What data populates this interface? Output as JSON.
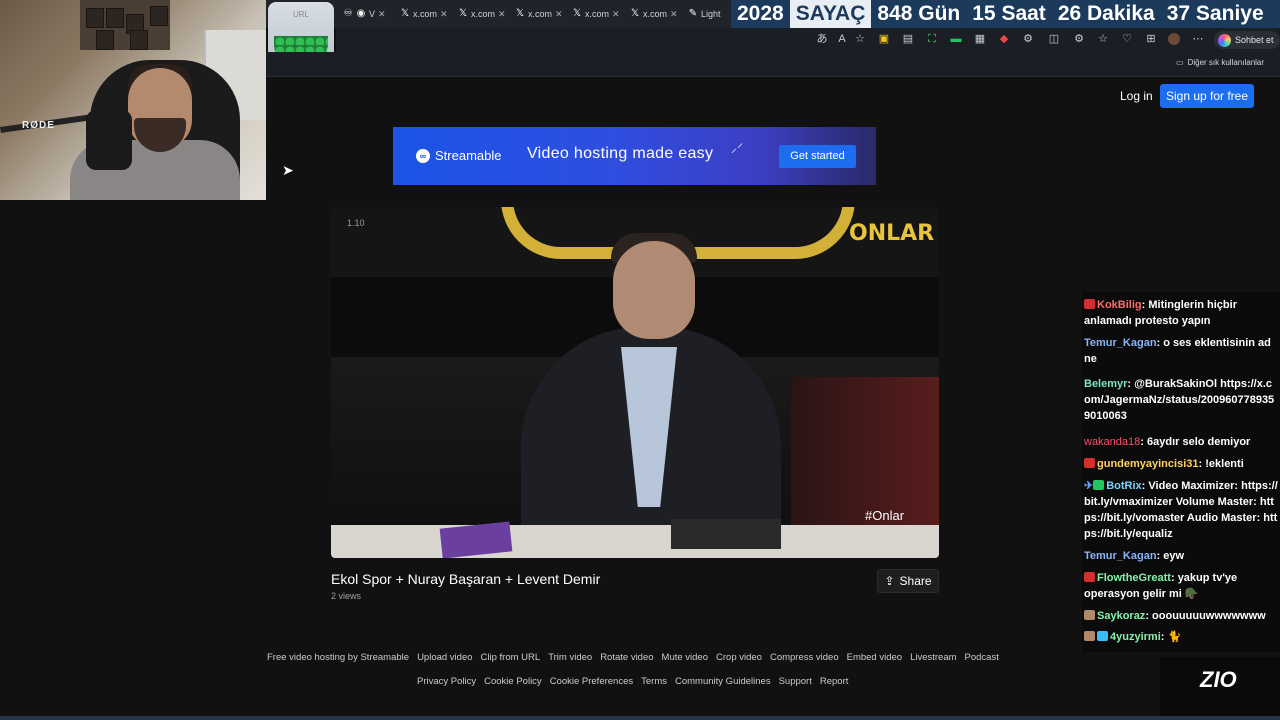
{
  "browser": {
    "url_widget_label": "URL",
    "tabs": [
      {
        "icon": "♾",
        "label": "V"
      },
      {
        "icon": "𝕏",
        "label": "x.com"
      },
      {
        "icon": "𝕏",
        "label": "x.com"
      },
      {
        "icon": "𝕏",
        "label": "x.com"
      },
      {
        "icon": "𝕏",
        "label": "x.com"
      },
      {
        "icon": "𝕏",
        "label": "x.com"
      },
      {
        "icon": "✎",
        "label": "Light"
      }
    ],
    "counter": {
      "year": "2028",
      "title": "SAYAÇ",
      "days": "848 Gün",
      "hours": "15 Saat",
      "minutes": "26 Dakika",
      "seconds": "37 Saniye"
    },
    "chat_button": "Sohbet et",
    "favorites_other": "Diğer sık kullanılanlar"
  },
  "header": {
    "login": "Log in",
    "signup": "Sign up for free"
  },
  "banner": {
    "brand": "Streamable",
    "tagline": "Video hosting made easy",
    "cta": "Get started"
  },
  "video": {
    "timestamp": "1.10",
    "channel_logo": "ONLAR",
    "hashtag": "#Onlar",
    "title": "Ekol Spor + Nuray Başaran + Levent Demir",
    "views": "2 views",
    "share": "Share"
  },
  "footer": {
    "row1": [
      "Free video hosting by Streamable",
      "Upload video",
      "Clip from URL",
      "Trim video",
      "Rotate video",
      "Mute video",
      "Crop video",
      "Compress video",
      "Embed video",
      "Livestream",
      "Podcast"
    ],
    "row2": [
      "Privacy Policy",
      "Cookie Policy",
      "Cookie Preferences",
      "Terms",
      "Community Guidelines",
      "Support",
      "Report"
    ]
  },
  "chat": {
    "messages": [
      {
        "user": "KokBilig",
        "color": "#ff4d4d",
        "badge": "#d32f2f",
        "text": "Mitinglerin hiçbir anlamadı protesto yapın"
      },
      {
        "user": "Temur_Kagan",
        "color": "#8ab4f8",
        "badge": "",
        "text": "o ses eklentisinin ad ne"
      },
      {
        "user": "Belemyr",
        "color": "#7be3c7",
        "badge": "",
        "text": "@BurakSakinOl https://x.com/JagermaNz/status/2009607789359010063"
      },
      {
        "user": "wakanda18",
        "color": "#ff4d6d",
        "badge": "",
        "text": "6aydır selo demiyor"
      },
      {
        "user": "gundemyayincisi31",
        "color": "#ffd166",
        "badge": "#d32f2f",
        "text": "!eklenti"
      },
      {
        "user": "BotRix",
        "color": "#7dd3fc",
        "badge": "#22c55e",
        "text": "Video Maximizer: https://bit.ly/vmaximizer Volume Master: https://bit.ly/vomaster Audio Master: https://bit.ly/equaliz"
      },
      {
        "user": "Temur_Kagan",
        "color": "#8ab4f8",
        "badge": "",
        "text": "eyw"
      },
      {
        "user": "FlowtheGreatt",
        "color": "#86efac",
        "badge": "#d32f2f",
        "text": "yakup tv'ye operasyon gelir mi"
      },
      {
        "user": "Saykoraz",
        "color": "#86efac",
        "badge": "#b08968",
        "text": "ooouuuuuwwwwwww"
      },
      {
        "user": "4yuzyirmi",
        "color": "#86efac",
        "badge": "#b08968",
        "text": ""
      }
    ]
  },
  "overlay_logo": {
    "text": "ZIO"
  }
}
